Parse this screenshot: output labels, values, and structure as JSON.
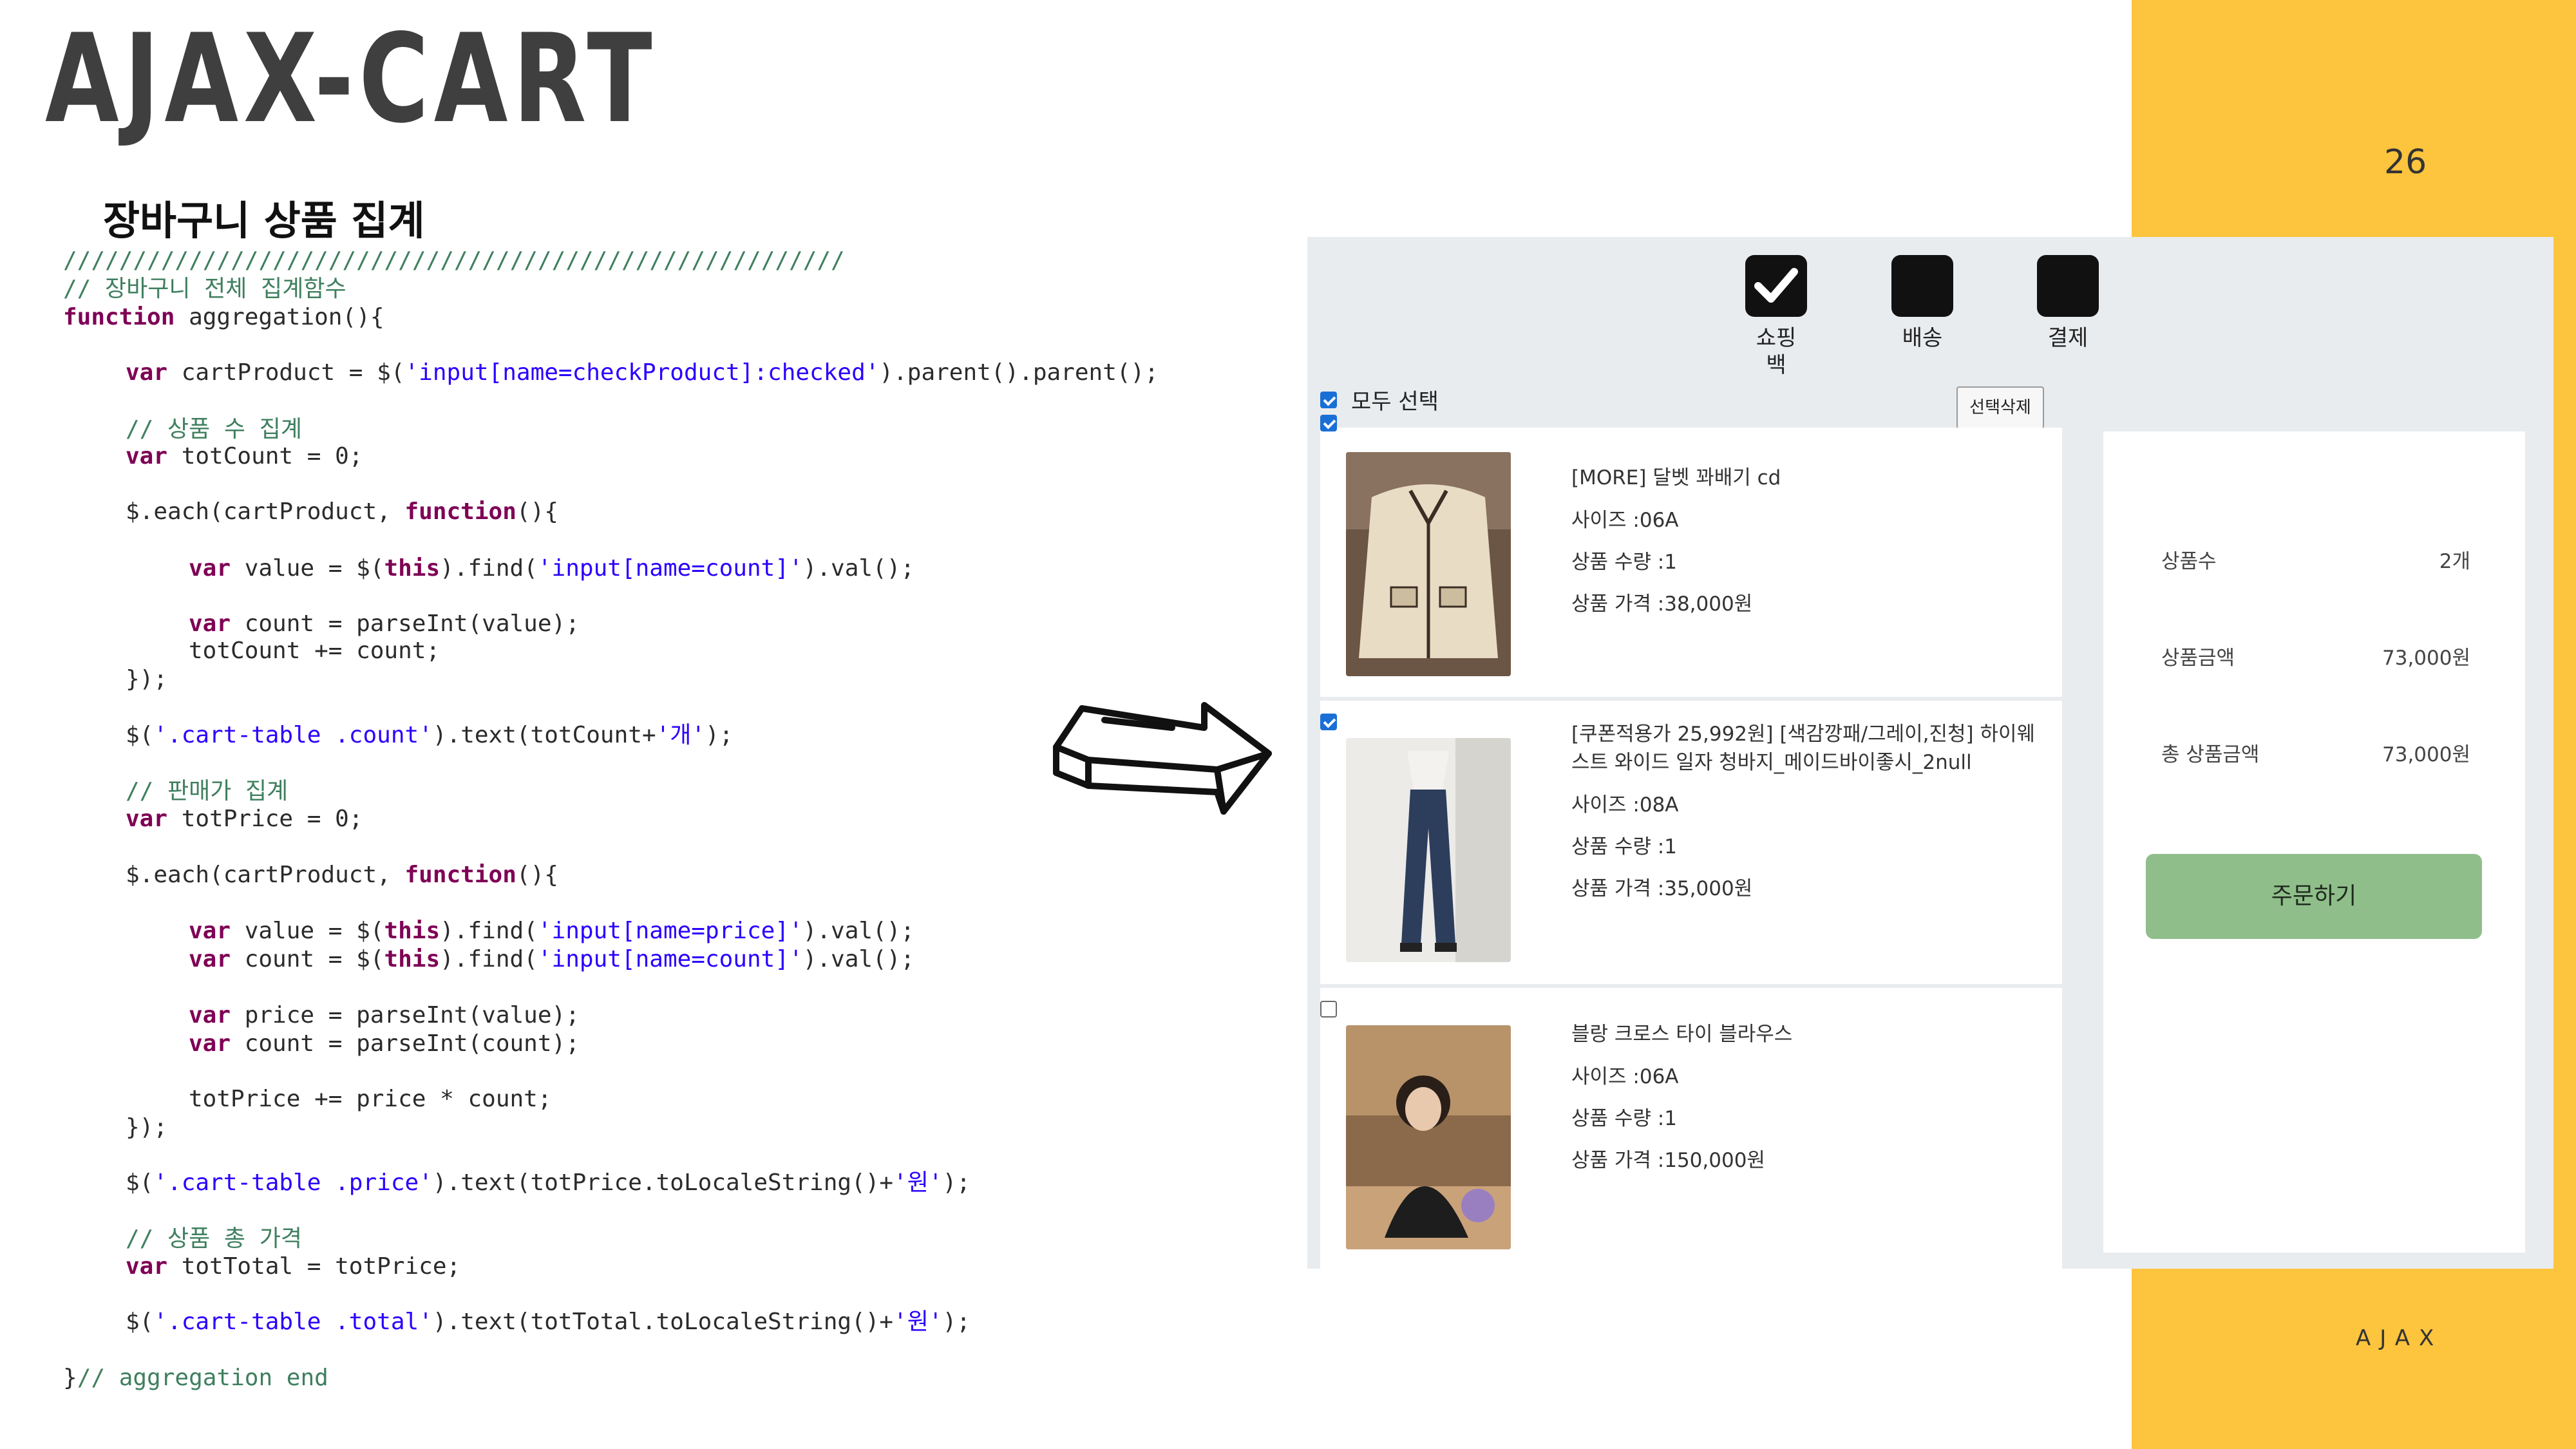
{
  "slide": {
    "title": "AJAX-CART",
    "page_number": "26",
    "footer": "AJAX",
    "subtitle": "장바구니 상품 집계"
  },
  "code": {
    "lines": [
      "////////////////////////////////////////////////////////",
      "// 장바구니 전체 집계함수",
      "function aggregation(){",
      "var cartProduct = $('input[name=checkProduct]:checked').parent().parent();",
      "// 상품 수 집계",
      "var totCount = 0;",
      "$.each(cartProduct, function(){",
      "var value = $(this).find('input[name=count]').val();",
      "var count = parseInt(value);",
      "totCount += count;",
      "});",
      "$('.cart-table .count').text(totCount+'개');",
      "// 판매가 집계",
      "var totPrice = 0;",
      "$.each(cartProduct, function(){",
      "var value = $(this).find('input[name=price]').val();",
      "var count = $(this).find('input[name=count]').val();",
      "var price = parseInt(value);",
      "var count = parseInt(count);",
      "totPrice += price * count;",
      "});",
      "$('.cart-table .price').text(totPrice.toLocaleString()+'원');",
      "// 상품 총 가격",
      "var totTotal = totPrice;",
      "$('.cart-table .total').text(totTotal.toLocaleString()+'원');",
      "}// aggregation end"
    ]
  },
  "cart": {
    "steps": [
      {
        "label": "쇼핑\n백",
        "icon": "check-icon"
      },
      {
        "label": "배송",
        "icon": "box-icon"
      },
      {
        "label": "결제",
        "icon": "box-icon"
      }
    ],
    "select_all_label": "모두 선택",
    "select_all_checked": true,
    "delete_button": "선택삭제",
    "items": [
      {
        "checked": true,
        "name": "[MORE] 달벳 꽈배기 cd",
        "size": "사이즈 :06A",
        "qty": "상품 수량 :1",
        "price": "상품 가격 :38,000원"
      },
      {
        "checked": true,
        "name": "[쿠폰적용가 25,992원] [색감깡패/그레이,진청] 하이웨스트 와이드 일자 청바지_메이드바이좋시_2null",
        "size": "사이즈 :08A",
        "qty": "상품 수량 :1",
        "price": "상품 가격 :35,000원"
      },
      {
        "checked": false,
        "name": "블랑 크로스 타이 블라우스",
        "size": "사이즈 :06A",
        "qty": "상품 수량 :1",
        "price": "상품 가격 :150,000원"
      }
    ],
    "summary": {
      "count_label": "상품수",
      "count_value": "2개",
      "amount_label": "상품금액",
      "amount_value": "73,000원",
      "total_label": "총 상품금액",
      "total_value": "73,000원",
      "order_button": "주문하기"
    }
  },
  "colors": {
    "accent_yellow": "#fdc43e",
    "order_button": "#8fbe8a",
    "code_comment": "#3f7f5f",
    "code_keyword": "#7f0055",
    "code_string": "#2a00ff"
  }
}
